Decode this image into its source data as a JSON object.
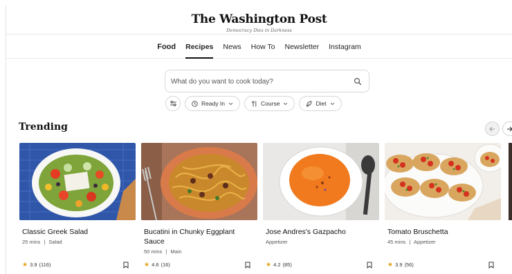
{
  "header": {
    "logo": "The Washington Post",
    "tagline": "Democracy Dies in Darkness"
  },
  "nav": {
    "items": [
      {
        "label": "Food"
      },
      {
        "label": "Recipes"
      },
      {
        "label": "News"
      },
      {
        "label": "How To"
      },
      {
        "label": "Newsletter"
      },
      {
        "label": "Instagram"
      }
    ],
    "active": "Recipes"
  },
  "search": {
    "placeholder": "What do you want to cook today?",
    "value": "",
    "icon": "search-icon"
  },
  "filters": {
    "toggle_icon": "sliders-icon",
    "pills": [
      {
        "label": "Ready In",
        "icon": "clock-icon"
      },
      {
        "label": "Course",
        "icon": "utensils-icon"
      },
      {
        "label": "Diet",
        "icon": "leaf-icon"
      }
    ]
  },
  "trending": {
    "title": "Trending",
    "recipes": [
      {
        "title": "Classic Greek Salad",
        "time": "25 mins",
        "category": "Salad",
        "rating": "3.9",
        "count": "(116)"
      },
      {
        "title": "Bucatini in Chunky Eggplant Sauce",
        "time": "50 mins",
        "category": "Main",
        "rating": "4.6",
        "count": "(16)"
      },
      {
        "title": "Jose Andres's Gazpacho",
        "time": "",
        "category": "Appetizer",
        "rating": "4.2",
        "count": "(85)"
      },
      {
        "title": "Tomato Bruschetta",
        "time": "45 mins",
        "category": "Appetizer",
        "rating": "3.9",
        "count": "(56)"
      }
    ],
    "meta_separator": "|"
  },
  "colors": {
    "star": "#e4a112",
    "text": "#111111",
    "muted": "#555555",
    "border": "#d6d6d6"
  }
}
